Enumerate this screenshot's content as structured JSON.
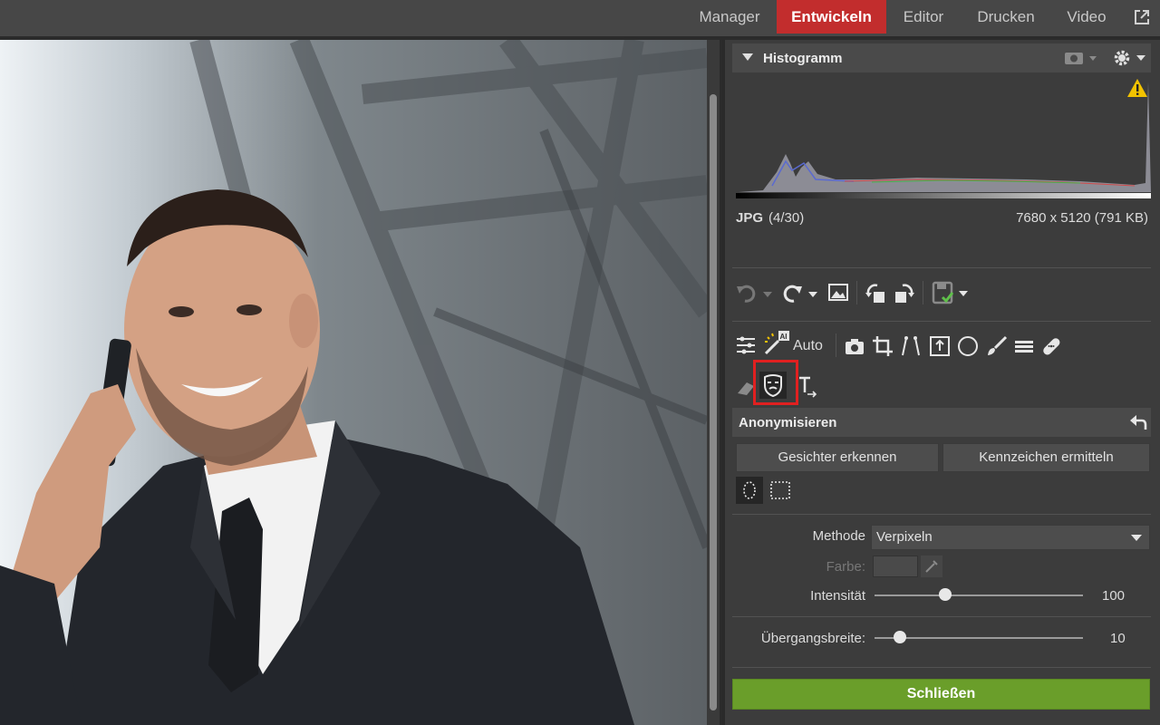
{
  "tabs": [
    {
      "label": "Manager"
    },
    {
      "label": "Entwickeln",
      "active": true
    },
    {
      "label": "Editor"
    },
    {
      "label": "Drucken"
    },
    {
      "label": "Video"
    }
  ],
  "histogram": {
    "title": "Histogramm",
    "format": "JPG",
    "index": "(4/30)",
    "dimensions": "7680 x 5120 (791 KB)"
  },
  "tools": {
    "auto_label": "Auto",
    "selected_tool": "anonymize-icon"
  },
  "anonymize": {
    "title": "Anonymisieren",
    "detect_faces_label": "Gesichter erkennen",
    "detect_plates_label": "Kennzeichen ermitteln",
    "method_label": "Methode",
    "method_value": "Verpixeln",
    "color_label": "Farbe:",
    "intensity_label": "Intensität",
    "intensity_value": "100",
    "transition_label": "Übergangsbreite:",
    "transition_value": "10"
  },
  "close_label": "Schließen",
  "colors": {
    "active_tab": "#c22d2d",
    "close_button": "#6a9e2a",
    "highlight_box": "#e02020",
    "warning": "#f2c200"
  }
}
